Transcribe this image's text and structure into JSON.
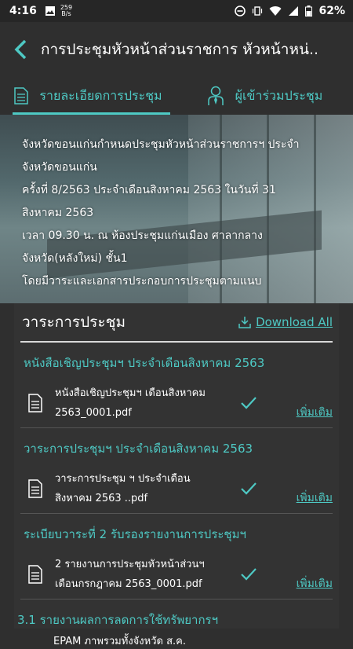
{
  "status": {
    "time": "4:16",
    "speed_value": "259",
    "speed_unit": "B/s",
    "battery": "62%"
  },
  "appbar": {
    "title": "การประชุมหัวหน้าส่วนราชการ หัวหน้าหน่.."
  },
  "tabs": [
    {
      "label": "รายละเอียดการประชุม",
      "icon": "document-icon"
    },
    {
      "label": "ผู้เข้าร่วมประชุม",
      "icon": "person-tie-icon"
    }
  ],
  "hero": {
    "lines": [
      " จังหวัดขอนแก่นกำหนดประชุมหัวหน้าส่วนราชการฯ ประจำ",
      "จังหวัดขอนแก่น",
      "ครั้งที่ 8/2563 ประจำเดือนสิงหาคม  2563 ในวันที่ 31",
      "สิงหาคม  2563",
      "เวลา 09.30 น. ณ ห้องประชุมแก่นเมือง ศาลากลาง",
      "จังหวัด(หลังใหม่) ชั้น1",
      "โดยมีวาระและเอกสารประกอบการประชุมตามแนบ"
    ]
  },
  "agenda": {
    "title": "วาระการประชุม",
    "download_label": "Download All",
    "sections": [
      {
        "title": "หนังสือเชิญประชุมฯ ประจำเดือนสิงหาคม 2563",
        "file_line1": "หนังสือเชิญประชุมฯ เดือนสิงหาคม",
        "file_line2": "2563_0001.pdf",
        "more": "เพิ่มเติม"
      },
      {
        "title": "วาระการประชุมฯ ประจำเดือนสิงหาคม 2563",
        "file_line1": "วาระการประชุม ฯ ประจำเดือน",
        "file_line2": "สิงหาคม  2563 ..pdf",
        "more": "เพิ่มเติม"
      },
      {
        "title": "ระเบียบวาระที่ 2 รับรองรายงานการประชุมฯ",
        "file_line1": "2 รายงานการประชุมหัวหน้าส่วนฯ",
        "file_line2": "เดือนกรกฎาคม 2563_0001.pdf",
        "more": "เพิ่มเติม"
      }
    ],
    "partial_title": "3.1 รายงานผลการลดการใช้ทรัพยากรฯ",
    "partial_file": "EPAM ภาพรวมทั้งจังหวัด ส.ค."
  },
  "colors": {
    "accent": "#4ec9c4",
    "background": "#2f2f2f"
  }
}
